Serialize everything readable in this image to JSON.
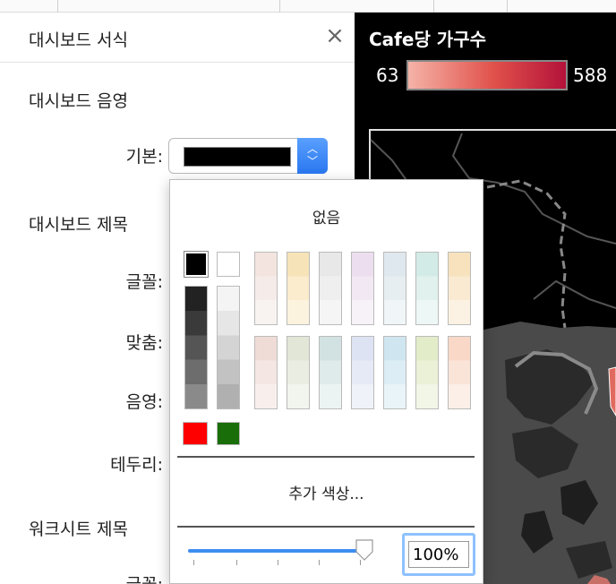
{
  "panel": {
    "title": "대시보드 서식",
    "close_glyph": "×",
    "shading_section": "대시보드 음영",
    "default_label": "기본:",
    "title_section": "대시보드 제목",
    "font_label": "글꼴:",
    "align_label": "맞춤:",
    "shading_label": "음영:",
    "border_label": "테두리:",
    "worksheet_title_section": "워크시트 제목",
    "worksheet_font_label": "글꼴:",
    "selected_color": "#000000"
  },
  "popup": {
    "none_label": "없음",
    "more_colors_label": "추가 색상...",
    "opacity_value": "100%",
    "opacity_fraction": 0.98
  },
  "map": {
    "title": "Cafe당 가구수",
    "legend_min": "63",
    "legend_max": "588",
    "colors": {
      "low": "#f5b3a7",
      "mid": "#e0504a",
      "high": "#b3123a"
    }
  }
}
